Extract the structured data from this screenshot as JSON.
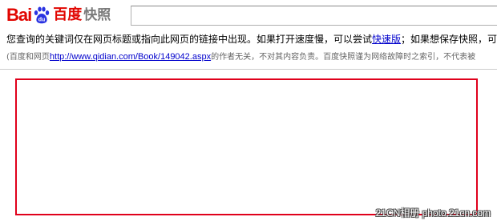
{
  "header": {
    "logo_bai": "Bai",
    "logo_du": "du",
    "logo_cn": "百度",
    "logo_kuaizhao": "快照",
    "search_value": ""
  },
  "notice": {
    "text_before": "您查询的关键词仅在网页标题或指向此网页的链接中出现。如果打开速度慢，可以尝试",
    "link": "快速版",
    "text_after": "；如果想保存快照，可"
  },
  "disclaimer": {
    "prefix": "(百度和网页",
    "url": "http://www.qidian.com/Book/149042.aspx",
    "suffix": "的作者无关，不对其内容负责。百度快照谨为网络故障时之索引，不代表被"
  },
  "watermark": "21CN相册 photo.21cn.com",
  "colors": {
    "brand_red": "#e10601",
    "link_blue": "#0000cc",
    "frame_red": "#e0001b"
  }
}
